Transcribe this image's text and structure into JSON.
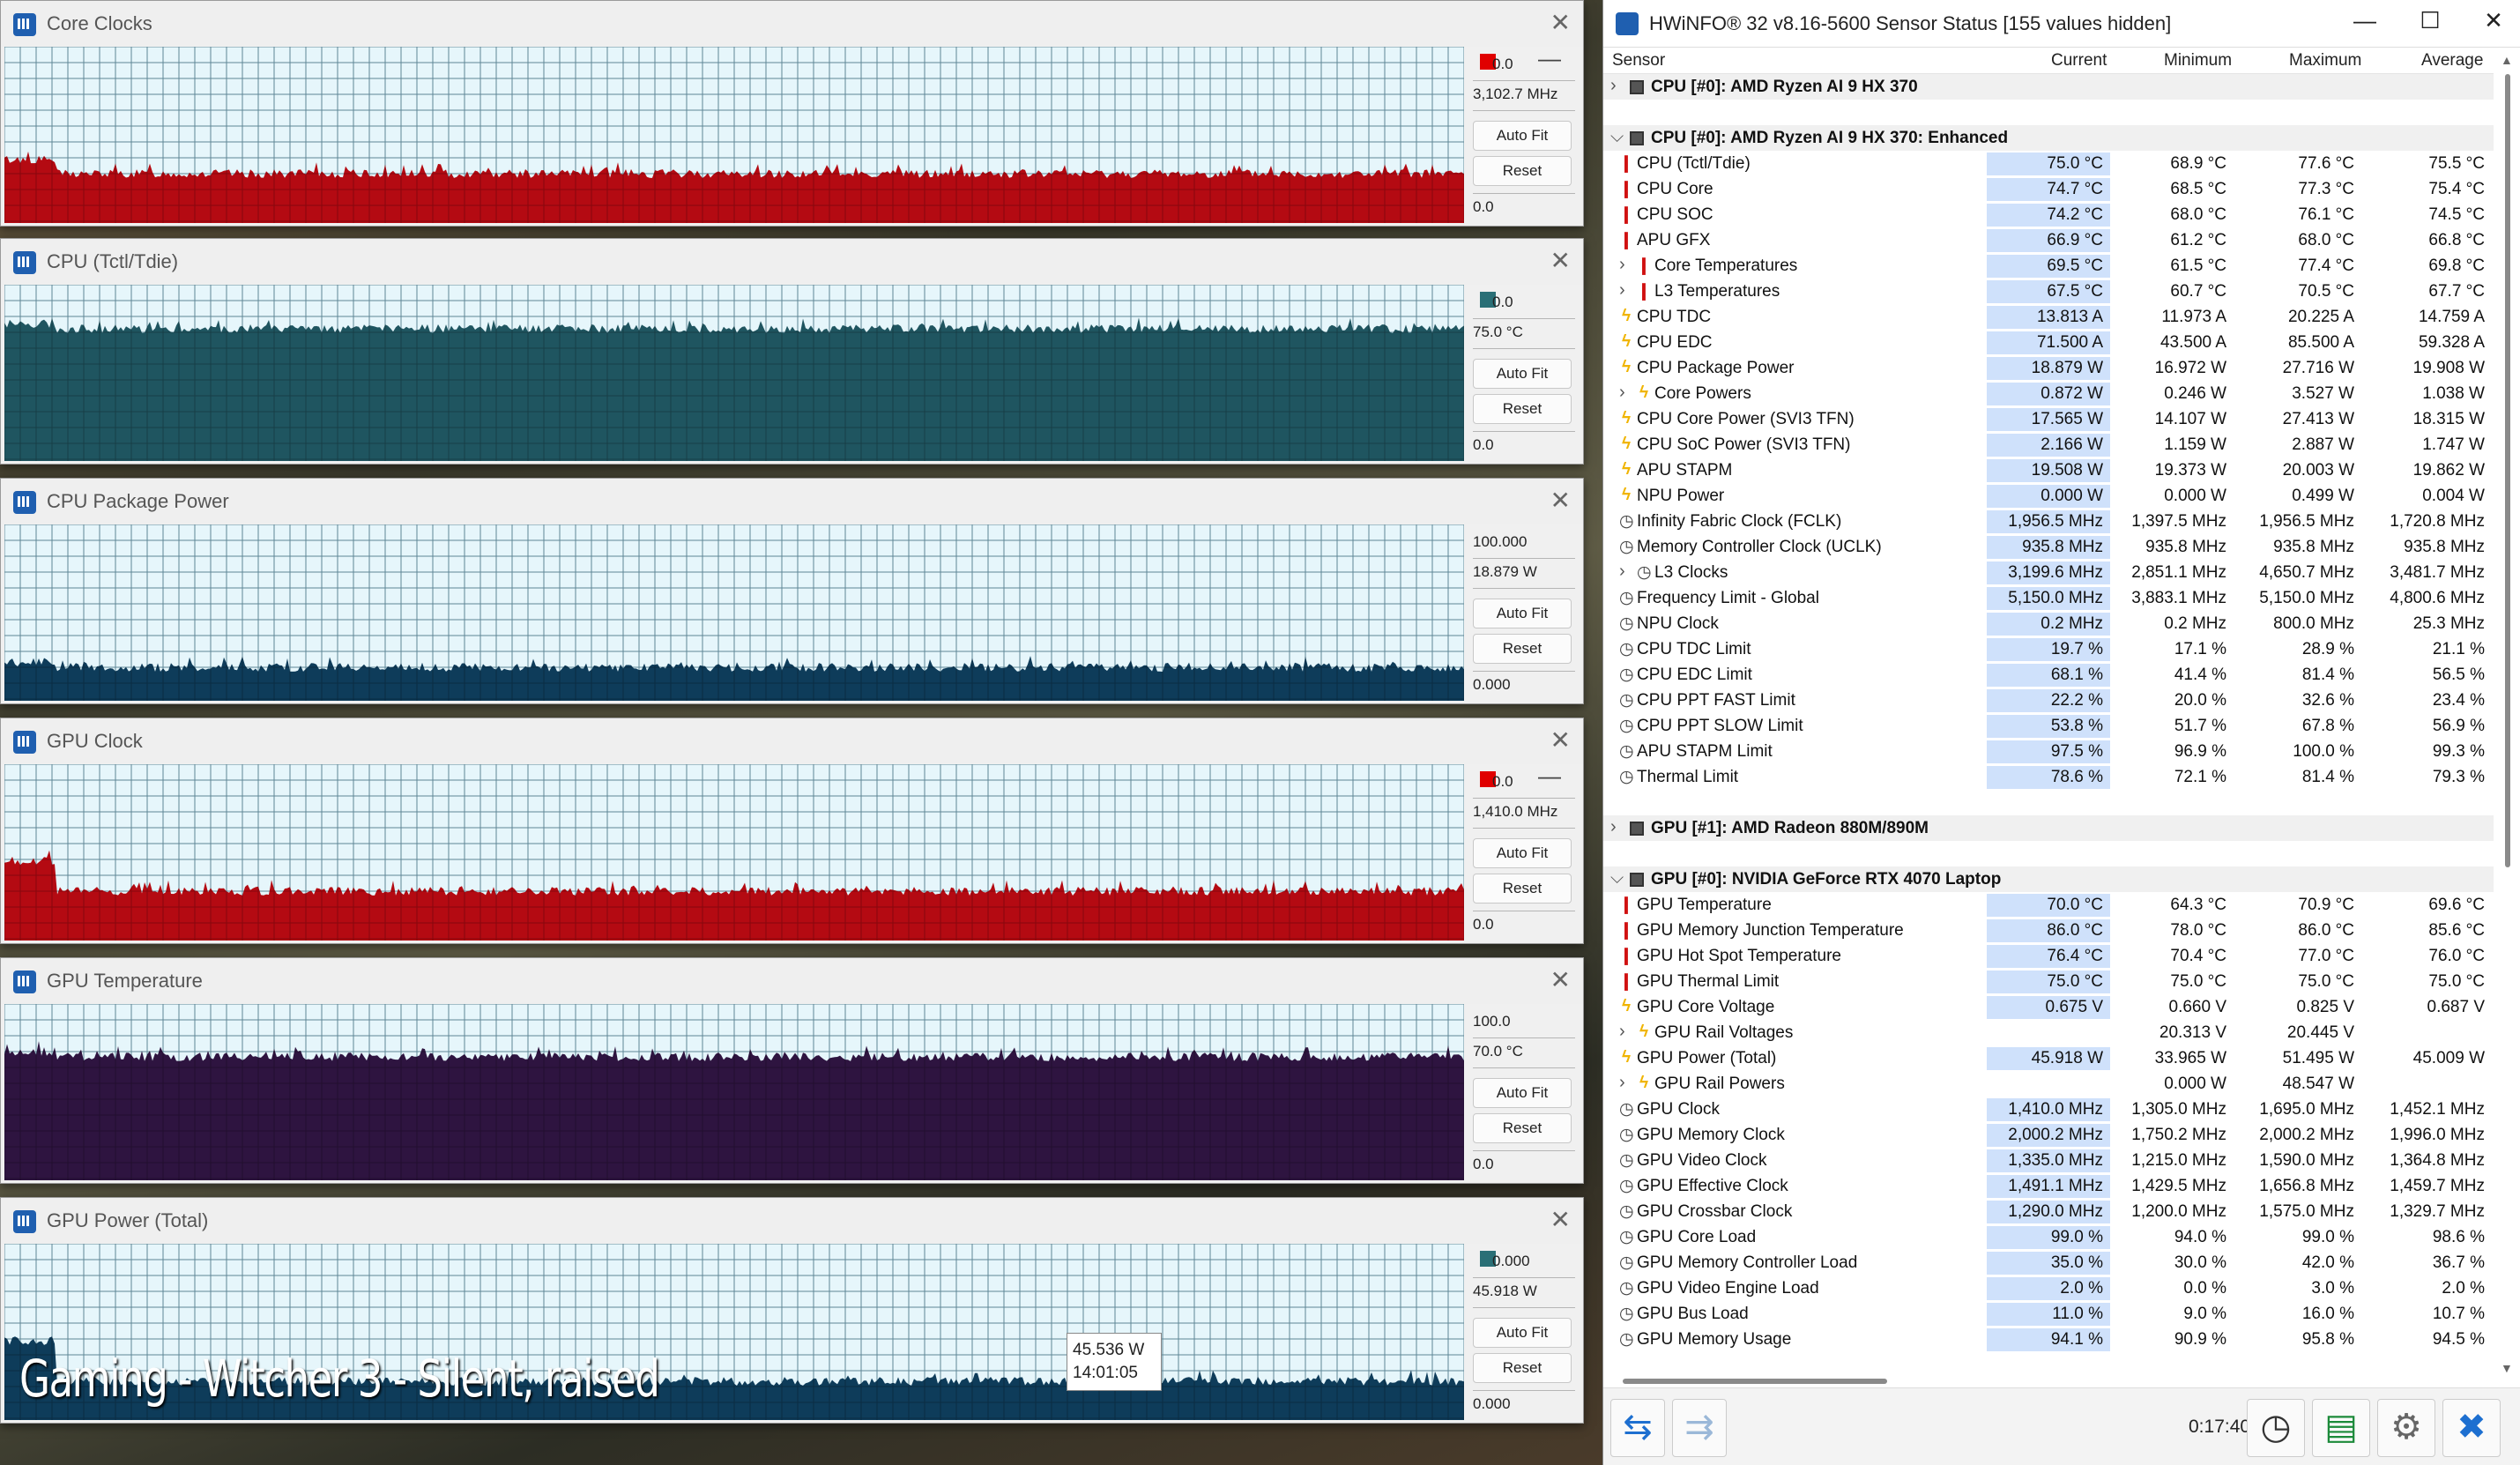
{
  "caption": "Gaming - Witcher 3 - Silent, raised",
  "tooltip": {
    "value": "45.536 W",
    "time": "14:01:05"
  },
  "graphs": [
    {
      "title": "Core Clocks",
      "max": "0.0",
      "current": "3,102.7 MHz",
      "min": "0.0",
      "autofit": "Auto Fit",
      "reset": "Reset",
      "color": "#b40a12",
      "level": 0.28,
      "top_level": 0.36,
      "swatch": "#e00000",
      "minimize": true
    },
    {
      "title": "CPU (Tctl/Tdie)",
      "max": "0.0",
      "current": "75.0 °C",
      "min": "0.0",
      "autofit": "Auto Fit",
      "reset": "Reset",
      "color": "#1f5560",
      "level": 0.75,
      "top_level": 0.78,
      "swatch": "#2a6f76",
      "minimize": false
    },
    {
      "title": "CPU Package Power",
      "max": "100.000",
      "current": "18.879 W",
      "min": "0.000",
      "autofit": "Auto Fit",
      "reset": "Reset",
      "color": "#0e3c5a",
      "level": 0.19,
      "top_level": 0.22,
      "swatch": null,
      "minimize": false
    },
    {
      "title": "GPU Clock",
      "max": "0.0",
      "current": "1,410.0 MHz",
      "min": "0.0",
      "autofit": "Auto Fit",
      "reset": "Reset",
      "color": "#b40a12",
      "level": 0.28,
      "top_level": 0.45,
      "swatch": "#e00000",
      "minimize": true
    },
    {
      "title": "GPU Temperature",
      "max": "100.0",
      "current": "70.0 °C",
      "min": "0.0",
      "autofit": "Auto Fit",
      "reset": "Reset",
      "color": "#2e1440",
      "level": 0.7,
      "top_level": 0.73,
      "swatch": null,
      "minimize": false
    },
    {
      "title": "GPU Power (Total)",
      "max": "0.000",
      "current": "45.918 W",
      "min": "0.000",
      "autofit": "Auto Fit",
      "reset": "Reset",
      "color": "#0e3c5a",
      "level": 0.22,
      "top_level": 0.45,
      "swatch": "#2a6f76",
      "minimize": false
    }
  ],
  "hwinfo": {
    "title": "HWiNFO® 32 v8.16-5600 Sensor Status [155 values hidden]",
    "columns": {
      "sensor": "Sensor",
      "current": "Current",
      "minimum": "Minimum",
      "maximum": "Maximum",
      "average": "Average"
    },
    "rows": [
      {
        "t": "grp",
        "exp": false,
        "name": "CPU [#0]: AMD Ryzen AI 9 HX 370"
      },
      {
        "t": "blank"
      },
      {
        "t": "grp",
        "exp": true,
        "name": "CPU [#0]: AMD Ryzen AI 9 HX 370: Enhanced"
      },
      {
        "t": "s",
        "i": "therm",
        "name": "CPU (Tctl/Tdie)",
        "cur": "75.0 °C",
        "min": "68.9 °C",
        "max": "77.6 °C",
        "avg": "75.5 °C"
      },
      {
        "t": "s",
        "i": "therm",
        "name": "CPU Core",
        "cur": "74.7 °C",
        "min": "68.5 °C",
        "max": "77.3 °C",
        "avg": "75.4 °C"
      },
      {
        "t": "s",
        "i": "therm",
        "name": "CPU SOC",
        "cur": "74.2 °C",
        "min": "68.0 °C",
        "max": "76.1 °C",
        "avg": "74.5 °C"
      },
      {
        "t": "s",
        "i": "therm",
        "name": "APU GFX",
        "cur": "66.9 °C",
        "min": "61.2 °C",
        "max": "68.0 °C",
        "avg": "66.8 °C"
      },
      {
        "t": "s",
        "i": "therm",
        "sub": true,
        "name": "Core Temperatures",
        "cur": "69.5 °C",
        "min": "61.5 °C",
        "max": "77.4 °C",
        "avg": "69.8 °C"
      },
      {
        "t": "s",
        "i": "therm",
        "sub": true,
        "name": "L3 Temperatures",
        "cur": "67.5 °C",
        "min": "60.7 °C",
        "max": "70.5 °C",
        "avg": "67.7 °C"
      },
      {
        "t": "s",
        "i": "bolt",
        "name": "CPU TDC",
        "cur": "13.813 A",
        "min": "11.973 A",
        "max": "20.225 A",
        "avg": "14.759 A"
      },
      {
        "t": "s",
        "i": "bolt",
        "name": "CPU EDC",
        "cur": "71.500 A",
        "min": "43.500 A",
        "max": "85.500 A",
        "avg": "59.328 A"
      },
      {
        "t": "s",
        "i": "bolt",
        "name": "CPU Package Power",
        "cur": "18.879 W",
        "min": "16.972 W",
        "max": "27.716 W",
        "avg": "19.908 W"
      },
      {
        "t": "s",
        "i": "bolt",
        "sub": true,
        "name": "Core Powers",
        "cur": "0.872 W",
        "min": "0.246 W",
        "max": "3.527 W",
        "avg": "1.038 W"
      },
      {
        "t": "s",
        "i": "bolt",
        "name": "CPU Core Power (SVI3 TFN)",
        "cur": "17.565 W",
        "min": "14.107 W",
        "max": "27.413 W",
        "avg": "18.315 W"
      },
      {
        "t": "s",
        "i": "bolt",
        "name": "CPU SoC Power (SVI3 TFN)",
        "cur": "2.166 W",
        "min": "1.159 W",
        "max": "2.887 W",
        "avg": "1.747 W"
      },
      {
        "t": "s",
        "i": "bolt",
        "name": "APU STAPM",
        "cur": "19.508 W",
        "min": "19.373 W",
        "max": "20.003 W",
        "avg": "19.862 W"
      },
      {
        "t": "s",
        "i": "bolt",
        "name": "NPU Power",
        "cur": "0.000 W",
        "min": "0.000 W",
        "max": "0.499 W",
        "avg": "0.004 W"
      },
      {
        "t": "s",
        "i": "clock",
        "name": "Infinity Fabric Clock (FCLK)",
        "cur": "1,956.5 MHz",
        "min": "1,397.5 MHz",
        "max": "1,956.5 MHz",
        "avg": "1,720.8 MHz"
      },
      {
        "t": "s",
        "i": "clock",
        "name": "Memory Controller Clock (UCLK)",
        "cur": "935.8 MHz",
        "min": "935.8 MHz",
        "max": "935.8 MHz",
        "avg": "935.8 MHz"
      },
      {
        "t": "s",
        "i": "clock",
        "sub": true,
        "name": "L3 Clocks",
        "cur": "3,199.6 MHz",
        "min": "2,851.1 MHz",
        "max": "4,650.7 MHz",
        "avg": "3,481.7 MHz"
      },
      {
        "t": "s",
        "i": "clock",
        "name": "Frequency Limit - Global",
        "cur": "5,150.0 MHz",
        "min": "3,883.1 MHz",
        "max": "5,150.0 MHz",
        "avg": "4,800.6 MHz"
      },
      {
        "t": "s",
        "i": "clock",
        "name": "NPU Clock",
        "cur": "0.2 MHz",
        "min": "0.2 MHz",
        "max": "800.0 MHz",
        "avg": "25.3 MHz"
      },
      {
        "t": "s",
        "i": "clock",
        "name": "CPU TDC Limit",
        "cur": "19.7 %",
        "min": "17.1 %",
        "max": "28.9 %",
        "avg": "21.1 %"
      },
      {
        "t": "s",
        "i": "clock",
        "name": "CPU EDC Limit",
        "cur": "68.1 %",
        "min": "41.4 %",
        "max": "81.4 %",
        "avg": "56.5 %"
      },
      {
        "t": "s",
        "i": "clock",
        "name": "CPU PPT FAST Limit",
        "cur": "22.2 %",
        "min": "20.0 %",
        "max": "32.6 %",
        "avg": "23.4 %"
      },
      {
        "t": "s",
        "i": "clock",
        "name": "CPU PPT SLOW Limit",
        "cur": "53.8 %",
        "min": "51.7 %",
        "max": "67.8 %",
        "avg": "56.9 %"
      },
      {
        "t": "s",
        "i": "clock",
        "name": "APU STAPM Limit",
        "cur": "97.5 %",
        "min": "96.9 %",
        "max": "100.0 %",
        "avg": "99.3 %"
      },
      {
        "t": "s",
        "i": "clock",
        "name": "Thermal Limit",
        "cur": "78.6 %",
        "min": "72.1 %",
        "max": "81.4 %",
        "avg": "79.3 %"
      },
      {
        "t": "blank"
      },
      {
        "t": "grp",
        "exp": false,
        "name": "GPU [#1]: AMD Radeon 880M/890M"
      },
      {
        "t": "blank"
      },
      {
        "t": "grp",
        "exp": true,
        "name": "GPU [#0]: NVIDIA GeForce RTX 4070 Laptop"
      },
      {
        "t": "s",
        "i": "therm",
        "name": "GPU Temperature",
        "cur": "70.0 °C",
        "min": "64.3 °C",
        "max": "70.9 °C",
        "avg": "69.6 °C"
      },
      {
        "t": "s",
        "i": "therm",
        "name": "GPU Memory Junction Temperature",
        "cur": "86.0 °C",
        "min": "78.0 °C",
        "max": "86.0 °C",
        "avg": "85.6 °C"
      },
      {
        "t": "s",
        "i": "therm",
        "name": "GPU Hot Spot Temperature",
        "cur": "76.4 °C",
        "min": "70.4 °C",
        "max": "77.0 °C",
        "avg": "76.0 °C"
      },
      {
        "t": "s",
        "i": "therm",
        "name": "GPU Thermal Limit",
        "cur": "75.0 °C",
        "min": "75.0 °C",
        "max": "75.0 °C",
        "avg": "75.0 °C"
      },
      {
        "t": "s",
        "i": "bolt",
        "name": "GPU Core Voltage",
        "cur": "0.675 V",
        "min": "0.660 V",
        "max": "0.825 V",
        "avg": "0.687 V"
      },
      {
        "t": "s",
        "i": "bolt",
        "sub": true,
        "name": "GPU Rail Voltages",
        "cur": "",
        "min": "20.313 V",
        "max": "20.445 V",
        "avg": ""
      },
      {
        "t": "s",
        "i": "bolt",
        "name": "GPU Power (Total)",
        "cur": "45.918 W",
        "min": "33.965 W",
        "max": "51.495 W",
        "avg": "45.009 W"
      },
      {
        "t": "s",
        "i": "bolt",
        "sub": true,
        "name": "GPU Rail Powers",
        "cur": "",
        "min": "0.000 W",
        "max": "48.547 W",
        "avg": ""
      },
      {
        "t": "s",
        "i": "clock",
        "name": "GPU Clock",
        "cur": "1,410.0 MHz",
        "min": "1,305.0 MHz",
        "max": "1,695.0 MHz",
        "avg": "1,452.1 MHz"
      },
      {
        "t": "s",
        "i": "clock",
        "name": "GPU Memory Clock",
        "cur": "2,000.2 MHz",
        "min": "1,750.2 MHz",
        "max": "2,000.2 MHz",
        "avg": "1,996.0 MHz"
      },
      {
        "t": "s",
        "i": "clock",
        "name": "GPU Video Clock",
        "cur": "1,335.0 MHz",
        "min": "1,215.0 MHz",
        "max": "1,590.0 MHz",
        "avg": "1,364.8 MHz"
      },
      {
        "t": "s",
        "i": "clock",
        "name": "GPU Effective Clock",
        "cur": "1,491.1 MHz",
        "min": "1,429.5 MHz",
        "max": "1,656.8 MHz",
        "avg": "1,459.7 MHz"
      },
      {
        "t": "s",
        "i": "clock",
        "name": "GPU Crossbar Clock",
        "cur": "1,290.0 MHz",
        "min": "1,200.0 MHz",
        "max": "1,575.0 MHz",
        "avg": "1,329.7 MHz"
      },
      {
        "t": "s",
        "i": "clock",
        "name": "GPU Core Load",
        "cur": "99.0 %",
        "min": "94.0 %",
        "max": "99.0 %",
        "avg": "98.6 %"
      },
      {
        "t": "s",
        "i": "clock",
        "name": "GPU Memory Controller Load",
        "cur": "35.0 %",
        "min": "30.0 %",
        "max": "42.0 %",
        "avg": "36.7 %"
      },
      {
        "t": "s",
        "i": "clock",
        "name": "GPU Video Engine Load",
        "cur": "2.0 %",
        "min": "0.0 %",
        "max": "3.0 %",
        "avg": "2.0 %"
      },
      {
        "t": "s",
        "i": "clock",
        "name": "GPU Bus Load",
        "cur": "11.0 %",
        "min": "9.0 %",
        "max": "16.0 %",
        "avg": "10.7 %"
      },
      {
        "t": "s",
        "i": "clock",
        "name": "GPU Memory Usage",
        "cur": "94.1 %",
        "min": "90.9 %",
        "max": "95.8 %",
        "avg": "94.5 %"
      }
    ],
    "elapsed": "0:17:40"
  }
}
